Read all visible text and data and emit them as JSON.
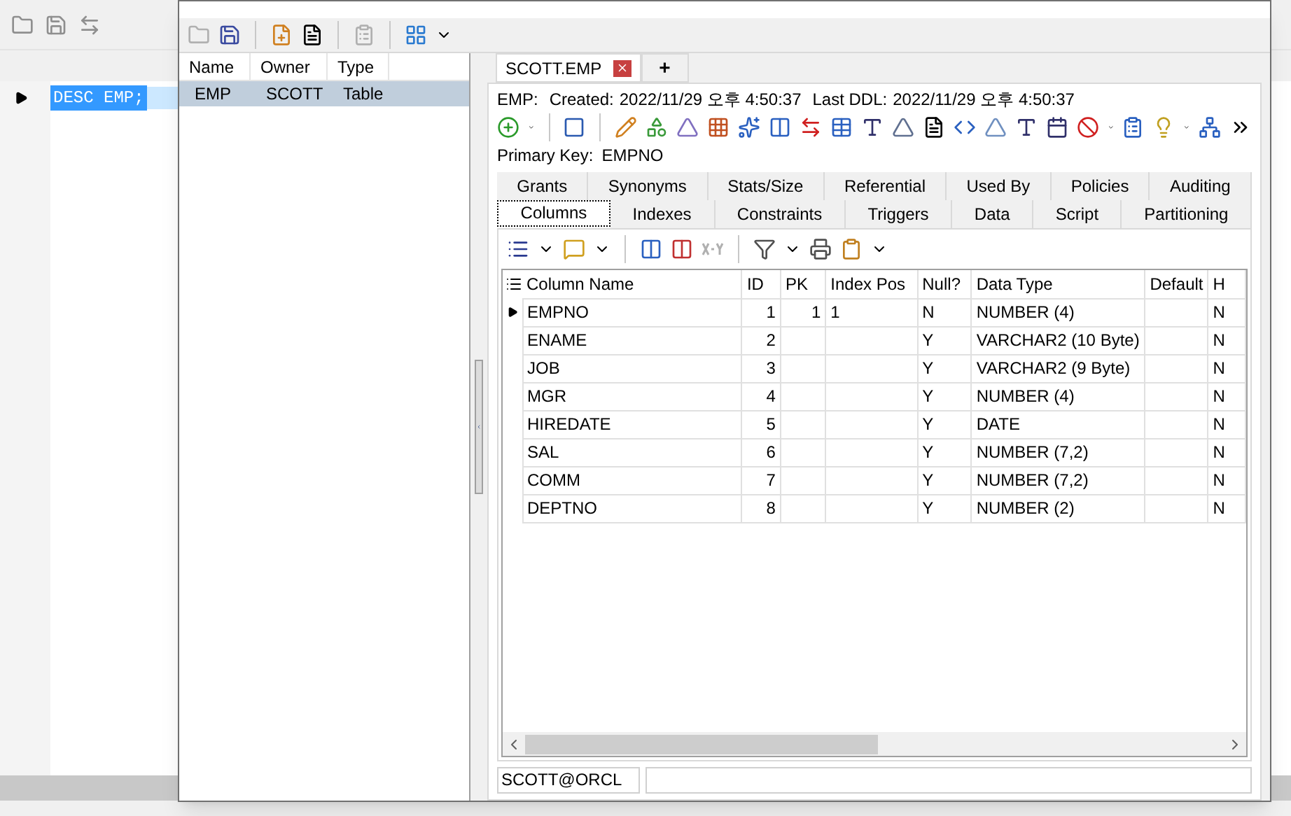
{
  "editor": {
    "lines": [
      {
        "text": "DESC EMP;",
        "current": true
      }
    ]
  },
  "objects_list": {
    "columns": [
      "Name",
      "Owner",
      "Type"
    ],
    "rows": [
      {
        "cells": [
          "EMP",
          "SCOTT",
          "Table"
        ],
        "selected": true
      }
    ]
  },
  "doc_tabs": [
    {
      "label": "SCOTT.EMP",
      "selected": true,
      "closable": true
    },
    {
      "label": "+",
      "selected": false,
      "closable": false
    }
  ],
  "info": {
    "object": "EMP:",
    "created_label": "Created:",
    "created": "2022/11/29 오후 4:50:37",
    "ddl_label": "Last DDL:",
    "ddl": "2022/11/29 오후 4:50:37"
  },
  "primary_key": {
    "label": "Primary Key:",
    "value": "EMPNO"
  },
  "detail_tabs": {
    "back_row": [
      {
        "label": "Grants",
        "selected": false
      },
      {
        "label": "Synonyms",
        "selected": false
      },
      {
        "label": "Stats/Size",
        "selected": false
      },
      {
        "label": "Referential",
        "selected": false
      },
      {
        "label": "Used By",
        "selected": false
      },
      {
        "label": "Policies",
        "selected": false
      },
      {
        "label": "Auditing",
        "selected": false
      }
    ],
    "front_row": [
      {
        "label": "Columns",
        "selected": true
      },
      {
        "label": "Indexes",
        "selected": false
      },
      {
        "label": "Constraints",
        "selected": false
      },
      {
        "label": "Triggers",
        "selected": false
      },
      {
        "label": "Data",
        "selected": false
      },
      {
        "label": "Script",
        "selected": false
      },
      {
        "label": "Partitioning",
        "selected": false
      }
    ]
  },
  "grid": {
    "columns": [
      "Column Name",
      "ID",
      "PK",
      "Index Pos",
      "Null?",
      "Data Type",
      "Default",
      "H"
    ],
    "rows": [
      {
        "current": true,
        "cells": [
          "EMPNO",
          "1",
          "1",
          "1",
          "N",
          "NUMBER (4)",
          "",
          "N"
        ]
      },
      {
        "current": false,
        "cells": [
          "ENAME",
          "2",
          "",
          "",
          "Y",
          "VARCHAR2 (10 Byte)",
          "",
          "N"
        ]
      },
      {
        "current": false,
        "cells": [
          "JOB",
          "3",
          "",
          "",
          "Y",
          "VARCHAR2 (9 Byte)",
          "",
          "N"
        ]
      },
      {
        "current": false,
        "cells": [
          "MGR",
          "4",
          "",
          "",
          "Y",
          "NUMBER (4)",
          "",
          "N"
        ]
      },
      {
        "current": false,
        "cells": [
          "HIREDATE",
          "5",
          "",
          "",
          "Y",
          "DATE",
          "",
          "N"
        ]
      },
      {
        "current": false,
        "cells": [
          "SAL",
          "6",
          "",
          "",
          "Y",
          "NUMBER (7,2)",
          "",
          "N"
        ]
      },
      {
        "current": false,
        "cells": [
          "COMM",
          "7",
          "",
          "",
          "Y",
          "NUMBER (7,2)",
          "",
          "N"
        ]
      },
      {
        "current": false,
        "cells": [
          "DEPTNO",
          "8",
          "",
          "",
          "Y",
          "NUMBER (2)",
          "",
          "N"
        ]
      }
    ]
  },
  "status_bar": [
    "SCOTT@ORCL"
  ]
}
